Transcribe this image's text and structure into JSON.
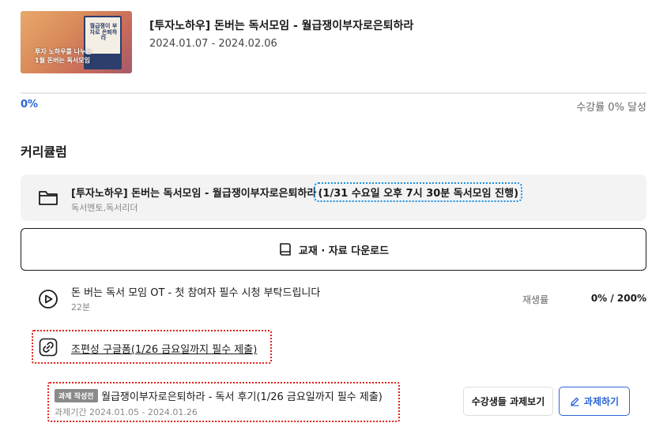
{
  "course": {
    "thumbnail": {
      "book_title": "월급쟁이 부자로 은퇴하라",
      "overlay_line1": "투자 노하우를 나누는",
      "overlay_line2": "1월 돈버는 독서모임"
    },
    "title": "[투자노하우] 돈버는 독서모임 - 월급쟁이부자로은퇴하라",
    "period": "2024.01.07 - 2024.02.06"
  },
  "progress": {
    "percent_label": "0%",
    "rate_label": "수강률 0% 달성",
    "fraction": 0
  },
  "curriculum": {
    "section_title": "커리큘럼",
    "chapter": {
      "title_main": "[투자노하우] 돈버는 독서모임 - 월급쟁이부자로은퇴하라",
      "title_highlight": "(1/31 수요일 오후 7시 30분 독서모임 진행)",
      "subtitle": "독서멘토,독서리더",
      "icon": "folder-icon"
    },
    "download": {
      "label": "교재 · 자료 다운로드",
      "icon": "book-icon"
    },
    "lesson": {
      "title": "돈 버는 독서 모임 OT - 첫 참여자 필수 시청 부탁드립니다",
      "duration": "22분",
      "play_label": "재생률",
      "play_value": "0% / 200%",
      "icon": "play-circle-icon"
    },
    "link": {
      "label": "조편성 구글폼(1/26 금요일까지 필수 제출)",
      "icon": "link-icon"
    },
    "assignment": {
      "badge": "과제 작성전",
      "title": "월급쟁이부자로은퇴하라 - 독서 후기(1/26 금요일까지 필수 제출)",
      "period": "과제기간 2024.01.05 - 2024.01.26",
      "view_button": "수강생들 과제보기",
      "do_button": "과제하기",
      "do_icon": "pencil-icon"
    }
  },
  "colors": {
    "accent": "#2a64d6",
    "highlight_dotted": "#1e8fe0",
    "annotation_red": "#e0201a"
  }
}
